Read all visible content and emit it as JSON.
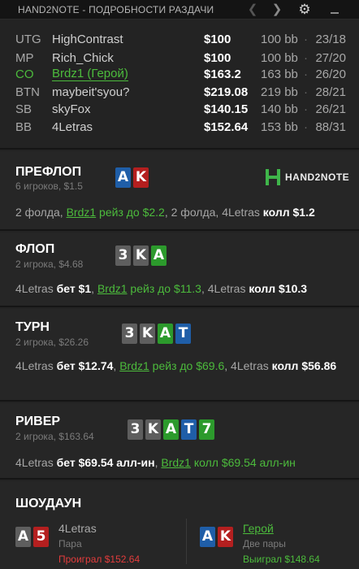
{
  "window": {
    "title": "HAND2NOTE - ПОДРОБНОСТИ РАЗДАЧИ",
    "icons": {
      "prev": "chevron-left-icon",
      "next": "chevron-right-icon",
      "settings": "gear-icon",
      "minimize": "minimize-icon"
    }
  },
  "players": [
    {
      "pos": "UTG",
      "name": "HighContrast",
      "stack": "$100",
      "bb": "100 bb",
      "stat": "23/18",
      "hero": false
    },
    {
      "pos": "MP",
      "name": "Rich_Chick",
      "stack": "$100",
      "bb": "100 bb",
      "stat": "27/20",
      "hero": false
    },
    {
      "pos": "CO",
      "name": "Brdz1 (Герой)",
      "stack": "$163.2",
      "bb": "163 bb",
      "stat": "26/20",
      "hero": true
    },
    {
      "pos": "BTN",
      "name": "maybeit'syou?",
      "stack": "$219.08",
      "bb": "219 bb",
      "stat": "28/21",
      "hero": false
    },
    {
      "pos": "SB",
      "name": "skyFox",
      "stack": "$140.15",
      "bb": "140 bb",
      "stat": "26/21",
      "hero": false
    },
    {
      "pos": "BB",
      "name": "4Letras",
      "stack": "$152.64",
      "bb": "153 bb",
      "stat": "88/31",
      "hero": false
    }
  ],
  "dot": "·",
  "logo": {
    "text": "HAND2NOTE",
    "color": "#3fb54a"
  },
  "streets": {
    "preflop": {
      "title": "ПРЕФЛОП",
      "sub": "6 игроков, $1.5",
      "cards": [
        {
          "rank": "A",
          "suit": "d"
        },
        {
          "rank": "K",
          "suit": "h"
        }
      ],
      "action": [
        {
          "t": "2 фолда, ",
          "c": "plain"
        },
        {
          "t": "Brdz1",
          "c": "hero"
        },
        {
          "t": " рейз до $2.2",
          "c": "herotext"
        },
        {
          "t": ", 2 фолда, 4Letras ",
          "c": "plain"
        },
        {
          "t": "колл $1.2",
          "c": "amt"
        }
      ]
    },
    "flop": {
      "title": "ФЛОП",
      "sub": "2 игрока, $4.68",
      "cards": [
        {
          "rank": "3",
          "suit": "s"
        },
        {
          "rank": "K",
          "suit": "s"
        },
        {
          "rank": "A",
          "suit": "c"
        }
      ],
      "action": [
        {
          "t": "4Letras ",
          "c": "plain"
        },
        {
          "t": "бет $1",
          "c": "amt"
        },
        {
          "t": ", ",
          "c": "plain"
        },
        {
          "t": "Brdz1",
          "c": "hero"
        },
        {
          "t": " рейз до $11.3",
          "c": "herotext"
        },
        {
          "t": ", 4Letras ",
          "c": "plain"
        },
        {
          "t": "колл $10.3",
          "c": "amt"
        }
      ]
    },
    "turn": {
      "title": "ТУРН",
      "sub": "2 игрока, $26.26",
      "cards": [
        {
          "rank": "3",
          "suit": "s"
        },
        {
          "rank": "K",
          "suit": "s"
        },
        {
          "rank": "A",
          "suit": "c"
        },
        {
          "rank": "T",
          "suit": "d"
        }
      ],
      "action": [
        {
          "t": "4Letras ",
          "c": "plain"
        },
        {
          "t": "бет $12.74",
          "c": "amt"
        },
        {
          "t": ", ",
          "c": "plain"
        },
        {
          "t": "Brdz1",
          "c": "hero"
        },
        {
          "t": " рейз до $69.6",
          "c": "herotext"
        },
        {
          "t": ", 4Letras ",
          "c": "plain"
        },
        {
          "t": "колл $56.86",
          "c": "amt"
        }
      ]
    },
    "river": {
      "title": "РИВЕР",
      "sub": "2 игрока, $163.64",
      "cards": [
        {
          "rank": "3",
          "suit": "s"
        },
        {
          "rank": "K",
          "suit": "s"
        },
        {
          "rank": "A",
          "suit": "c"
        },
        {
          "rank": "T",
          "suit": "d"
        },
        {
          "rank": "7",
          "suit": "c"
        }
      ],
      "action": [
        {
          "t": "4Letras ",
          "c": "plain"
        },
        {
          "t": "бет $69.54 алл-ин",
          "c": "amt"
        },
        {
          "t": ", ",
          "c": "plain"
        },
        {
          "t": "Brdz1",
          "c": "hero"
        },
        {
          "t": " колл $69.54 алл-ин",
          "c": "herotext"
        }
      ]
    }
  },
  "showdown": {
    "title": "ШОУДАУН",
    "left": {
      "name": "4Letras",
      "hand": "Пара",
      "result": "Проиграл $152.64",
      "outcome": "loss",
      "cards": [
        {
          "rank": "A",
          "suit": "s"
        },
        {
          "rank": "5",
          "suit": "h"
        }
      ]
    },
    "right": {
      "name": "Герой",
      "hand": "Две пары",
      "result": "Выиграл $148.64",
      "outcome": "win",
      "cards": [
        {
          "rank": "A",
          "suit": "d"
        },
        {
          "rank": "K",
          "suit": "h"
        }
      ]
    }
  },
  "colors": {
    "hero": "#4cbb3c",
    "loss": "#e23c3c",
    "win": "#4cbb3c",
    "suit_s": "#5e5e5e",
    "suit_h": "#b41f1f",
    "suit_d": "#1f5ea8",
    "suit_c": "#2c9a2c"
  }
}
